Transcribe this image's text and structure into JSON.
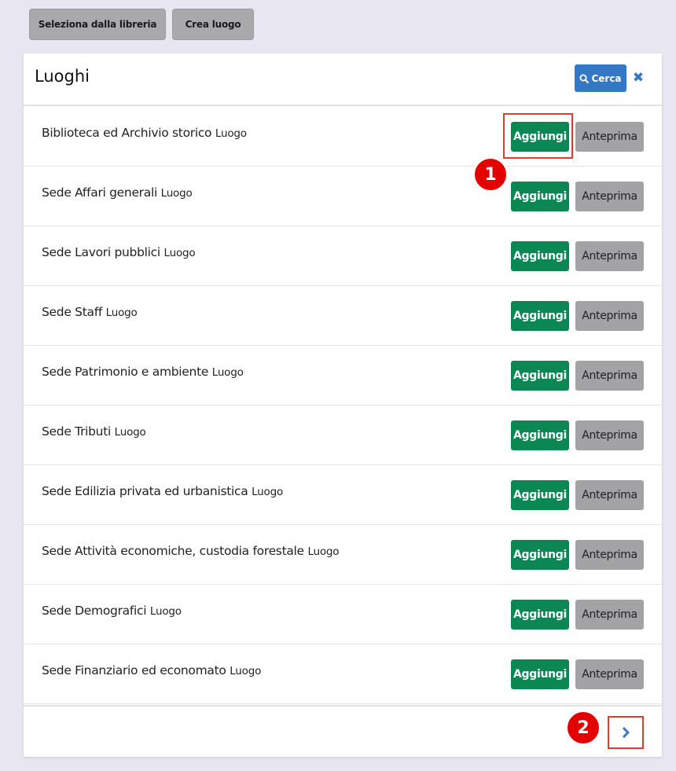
{
  "toolbar": {
    "select_library_label": "Seleziona dalla libreria",
    "create_place_label": "Crea luogo"
  },
  "panel": {
    "title": "Luoghi",
    "search_label": "Cerca",
    "close_icon": "close-icon",
    "search_icon": "search-icon",
    "add_label": "Aggiungi",
    "preview_label": "Anteprima",
    "items": [
      {
        "name": "Biblioteca ed Archivio storico",
        "type": "Luogo"
      },
      {
        "name": "Sede Affari generali",
        "type": "Luogo"
      },
      {
        "name": "Sede Lavori pubblici",
        "type": "Luogo"
      },
      {
        "name": "Sede Staff",
        "type": "Luogo"
      },
      {
        "name": "Sede Patrimonio e ambiente",
        "type": "Luogo"
      },
      {
        "name": "Sede Tributi",
        "type": "Luogo"
      },
      {
        "name": "Sede Edilizia privata ed urbanistica",
        "type": "Luogo"
      },
      {
        "name": "Sede Attività economiche, custodia forestale",
        "type": "Luogo"
      },
      {
        "name": "Sede Demografici",
        "type": "Luogo"
      },
      {
        "name": "Sede Finanziario ed economato",
        "type": "Luogo"
      }
    ],
    "next_icon": "chevron-right-icon"
  },
  "annotations": {
    "step1": "1",
    "step2": "2"
  },
  "colors": {
    "add_button": "#0a8753",
    "preview_button": "#a3a3a5",
    "search_button": "#3478c5",
    "annotation_red": "#e50000"
  }
}
